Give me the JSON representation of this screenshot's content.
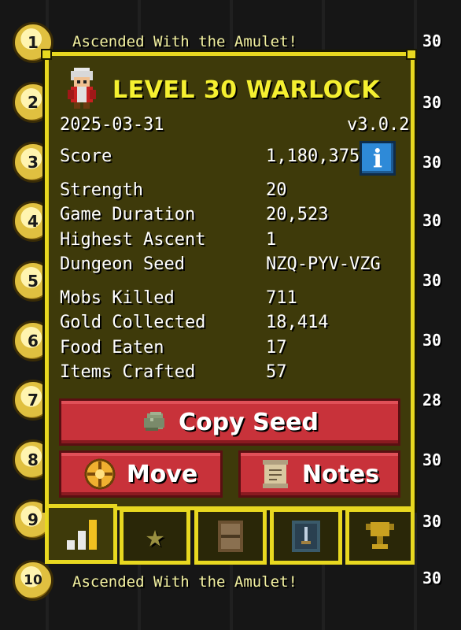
{
  "rows": [
    {
      "rank": "1",
      "text": "Ascended With the Amulet!",
      "level": "30"
    },
    {
      "rank": "2",
      "level": "30"
    },
    {
      "rank": "3",
      "level": "30"
    },
    {
      "rank": "4",
      "level": "30"
    },
    {
      "rank": "5",
      "level": "30"
    },
    {
      "rank": "6",
      "level": "30"
    },
    {
      "rank": "7",
      "level": "28"
    },
    {
      "rank": "8",
      "level": "30"
    },
    {
      "rank": "9",
      "level": "30"
    },
    {
      "rank": "10",
      "text": "Ascended With the Amulet!",
      "level": "30"
    }
  ],
  "panel": {
    "title": "LEVEL 30 WARLOCK",
    "date": "2025-03-31",
    "version": "v3.0.2",
    "score_label": "Score",
    "score_value": "1,180,375",
    "info_icon_label": "i",
    "stats_a": [
      {
        "label": "Strength",
        "value": "20"
      },
      {
        "label": "Game Duration",
        "value": "20,523"
      },
      {
        "label": "Highest Ascent",
        "value": "1"
      },
      {
        "label": "Dungeon Seed",
        "value": "NZQ-PYV-VZG"
      }
    ],
    "stats_b": [
      {
        "label": "Mobs Killed",
        "value": "711"
      },
      {
        "label": "Gold Collected",
        "value": "18,414"
      },
      {
        "label": "Food Eaten",
        "value": "17"
      },
      {
        "label": "Items Crafted",
        "value": "57"
      }
    ],
    "buttons": {
      "copy_seed": "Copy Seed",
      "move": "Move",
      "notes": "Notes"
    }
  },
  "tabs": [
    {
      "icon": "stats-bar-icon",
      "active": true
    },
    {
      "icon": "star-icon",
      "active": false
    },
    {
      "icon": "book-icon",
      "active": false
    },
    {
      "icon": "sword-badge-icon",
      "active": false
    },
    {
      "icon": "trophy-icon",
      "active": false
    }
  ],
  "colors": {
    "accent": "#e8d820",
    "panel_bg": "#3e3a0a",
    "button_red": "#c8323a",
    "info_blue": "#2e8ad8",
    "title_yellow": "#f5f030"
  }
}
